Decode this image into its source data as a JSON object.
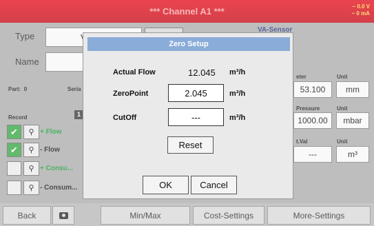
{
  "window": {
    "title": "*** Channel A1 ***",
    "status_voltage": "~ 0.0 V",
    "status_current": "~ 0 mA"
  },
  "form": {
    "type_label": "Type",
    "type_value_partial": "V",
    "name_label": "Name",
    "sensor_header": "VA-Sensor",
    "part_label": "Part:",
    "part_value": "0",
    "serial_label": "Seria",
    "record_label": "Record",
    "record_icon_text": "1"
  },
  "params": [
    {
      "header": "eter",
      "unit_header": "Unit",
      "value": "53.100",
      "unit": "mm"
    },
    {
      "header": "Pressure",
      "unit_header": "Unit",
      "value": "1000.00",
      "unit": "mbar"
    },
    {
      "header": "t.Val",
      "unit_header": "Unit",
      "value": "---",
      "unit": "m³"
    }
  ],
  "records": [
    {
      "label": "+ Flow",
      "checked": true
    },
    {
      "label": "- Flow",
      "checked": true
    },
    {
      "label": "+ Consu...",
      "checked": false
    },
    {
      "label": "- Consum...",
      "checked": false
    }
  ],
  "bottom": {
    "back": "Back",
    "camera_icon": "camera-icon",
    "minmax": "Min/Max",
    "cost": "Cost-Settings",
    "more": "More-Settings"
  },
  "dialog": {
    "title": "Zero Setup",
    "actual_flow_label": "Actual Flow",
    "actual_flow_value": "12.045",
    "actual_flow_unit": "m³/h",
    "zeropoint_label": "ZeroPoint",
    "zeropoint_value": "2.045",
    "zeropoint_unit": "m³/h",
    "cutoff_label": "CutOff",
    "cutoff_value": "---",
    "cutoff_unit": "m³/h",
    "reset": "Reset",
    "ok": "OK",
    "cancel": "Cancel"
  },
  "colors": {
    "title_red": "#e30613",
    "check_green": "#2ea33a",
    "dialog_header": "#8aacd8"
  }
}
